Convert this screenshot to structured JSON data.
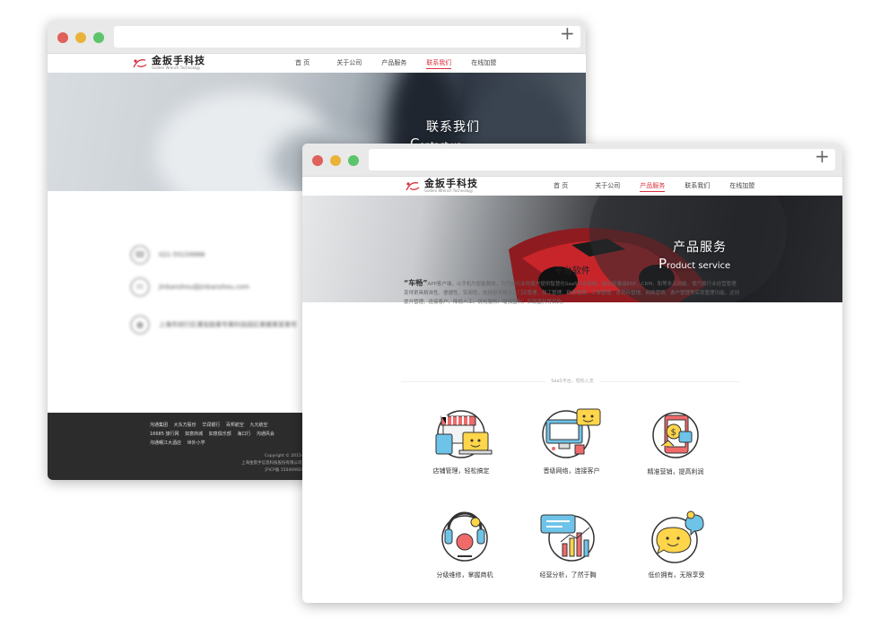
{
  "back_window": {
    "logo": {
      "cn": "金扳手科技",
      "en": "Golden Wrench Technology"
    },
    "nav": [
      "首 页",
      "关于公司",
      "产品服务",
      "联系我们",
      "在线加盟"
    ],
    "active_nav_index": 3,
    "banner": {
      "cn": "联系我们",
      "en_first": "C",
      "en_rest": "ontact us"
    },
    "contact": [
      {
        "icon": "phone-icon",
        "text": "021-55159966"
      },
      {
        "icon": "mail-icon",
        "text": "jinbanshou@jinbanshou.com"
      },
      {
        "icon": "location-icon",
        "text": "上海市闵行区漕宝路某号某科技园区某楼某室某号"
      }
    ],
    "footer_links": [
      "沟通集团",
      "大东方股份",
      "华润银行",
      "百邦航空",
      "九元航空",
      "16685 旅行网",
      "如意商城",
      "如意俱乐部",
      "海口行",
      "沟通风会",
      "沟通曙江大酒店",
      "世外小学"
    ],
    "footer_copy": [
      "Copyright © 2015-2",
      "上海金扳手信息科技股份有限公司 *",
      "沪ICP备 15040992号"
    ]
  },
  "front_window": {
    "logo": {
      "cn": "金扳手科技",
      "en": "Golden Wrench Technology"
    },
    "nav": [
      "首 页",
      "关于公司",
      "产品服务",
      "联系我们",
      "在线加盟"
    ],
    "active_nav_index": 2,
    "banner": {
      "cn": "产品服务",
      "en_first": "P",
      "en_rest": "roduct service"
    },
    "section_title": "平台软件",
    "intro_brand": "“车畅”",
    "intro_text": "APP客户端，以手机为智能载体，为汽修行业的客户提供智慧化SaaS平台系统，融合轻量级ERP、CRM、和等多元功能，使汽修行业经营管理变得更具精准性、便捷性、实用性。包括但不限于：门店管理、员工管理、财务管理、工单管理、进销存管理、网络营销、客户管理等实现管理功能。达到提升管理、连接客户、降低人工、优化服务、增强盈利、实现盈利等目的。",
    "divider_label": "SaaS平台，轻松入支",
    "features": [
      {
        "icon": "store-icon",
        "label": "店铺管理，轻松搞定"
      },
      {
        "icon": "network-icon",
        "label": "晋级网络，连接客户"
      },
      {
        "icon": "marketing-icon",
        "label": "精准营销，提高利润"
      },
      {
        "icon": "repair-icon",
        "label": "分级维修，掌握商机"
      },
      {
        "icon": "analytics-icon",
        "label": "经营分析，了然于胸"
      },
      {
        "icon": "price-icon",
        "label": "低价拥有，无限享受"
      }
    ]
  },
  "colors": {
    "accent": "#d9323d",
    "traffic_red": "#e0605a",
    "traffic_yellow": "#e9b33a",
    "traffic_green": "#5cc46a",
    "footer_bg": "#2c2c2c"
  }
}
